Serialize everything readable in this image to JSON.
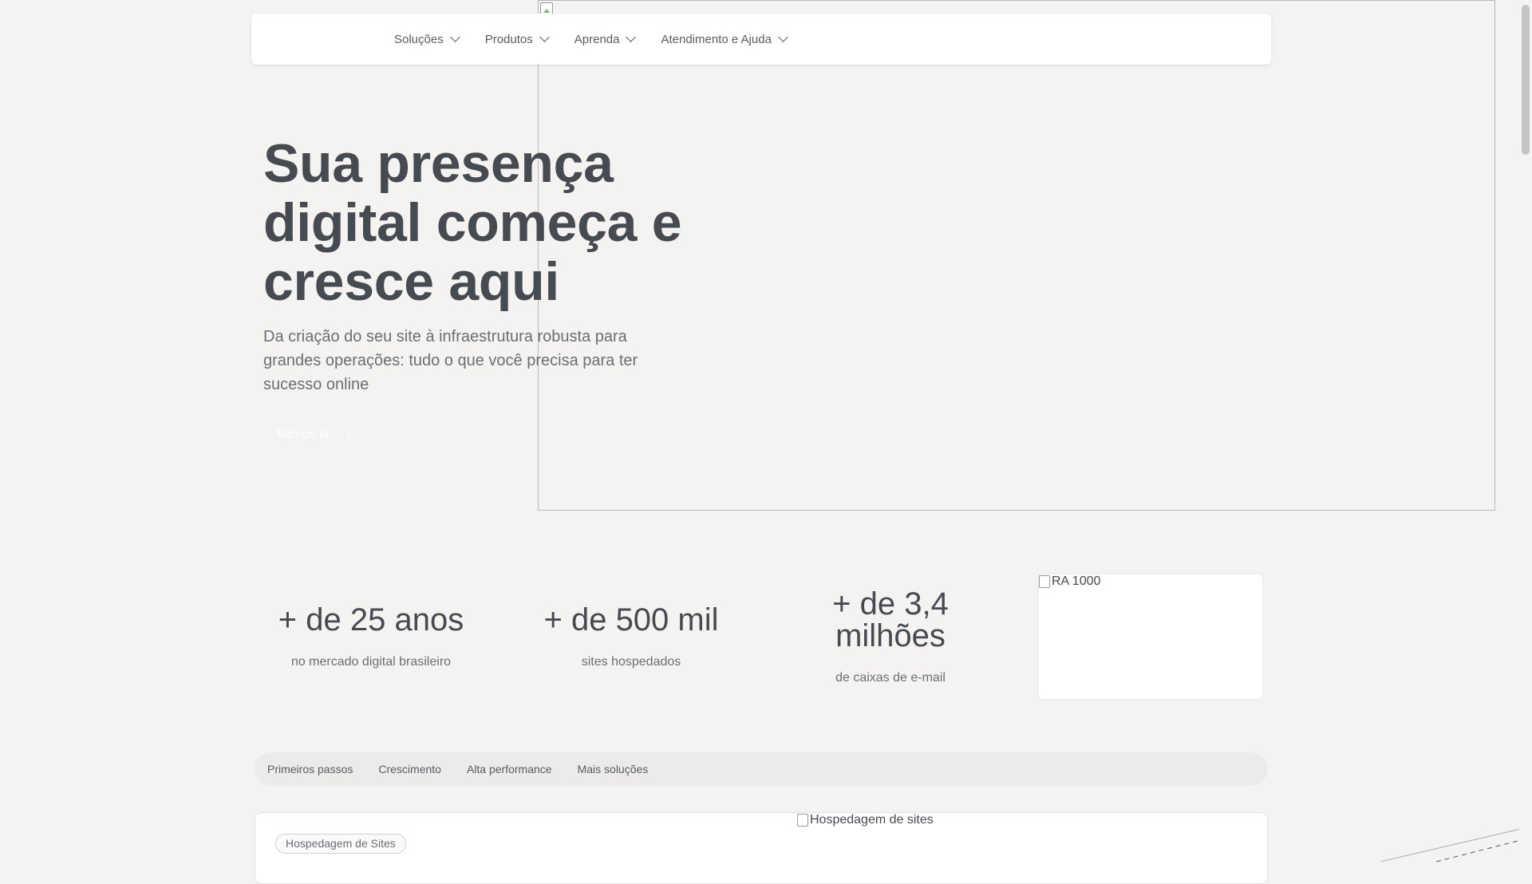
{
  "nav": {
    "items": [
      {
        "label": "Soluções"
      },
      {
        "label": "Produtos"
      },
      {
        "label": "Aprenda"
      },
      {
        "label": "Atendimento e Ajuda"
      }
    ]
  },
  "hero": {
    "title": "Sua presença digital começa e cresce aqui",
    "subtitle": "Da criação do seu site à infraestrutura robusta para grandes operações: tudo o que você precisa para ter sucesso online",
    "cta_label": "Vamos lá"
  },
  "stats": [
    {
      "value": "+ de 25 anos",
      "label": "no mercado digital brasileiro"
    },
    {
      "value": "+ de 500 mil",
      "label": "sites hospedados"
    },
    {
      "value": "+ de 3,4 milhões",
      "label": "de caixas de e-mail"
    }
  ],
  "ra_badge": {
    "alt": "RA 1000"
  },
  "tabs": [
    {
      "label": "Primeiros passos"
    },
    {
      "label": "Crescimento"
    },
    {
      "label": "Alta performance"
    },
    {
      "label": "Mais soluções"
    }
  ],
  "product_card": {
    "badge": "Hospedagem de Sites",
    "image_alt": "Hospedagem de sites"
  },
  "colors": {
    "background": "#f4f3f1",
    "text": "#464b52",
    "muted": "#6a6f75"
  }
}
